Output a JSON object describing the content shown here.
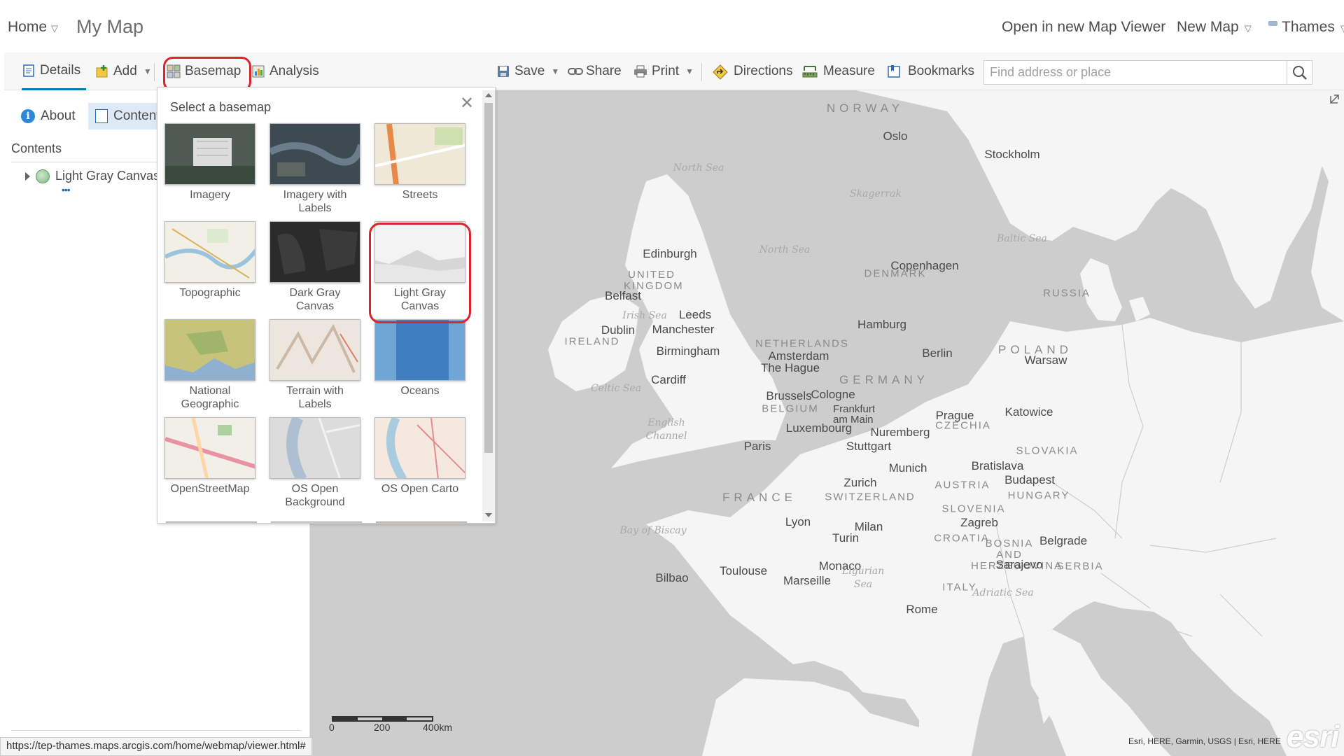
{
  "header": {
    "home_label": "Home",
    "map_title": "My Map",
    "open_new_viewer": "Open in new Map Viewer",
    "new_map": "New Map",
    "user_name": "Thames",
    "caret": "▽"
  },
  "toolbar": {
    "details": "Details",
    "add": "Add",
    "basemap": "Basemap",
    "analysis": "Analysis",
    "save": "Save",
    "share": "Share",
    "print": "Print",
    "directions": "Directions",
    "measure": "Measure",
    "bookmarks": "Bookmarks",
    "caret": "▼"
  },
  "search": {
    "placeholder": "Find address or place"
  },
  "left_panel": {
    "about_tab": "About",
    "content_tab": "Content",
    "contents_heading": "Contents",
    "layer_name": "Light Gray Canvas",
    "layer_options": "•••"
  },
  "gallery": {
    "heading": "Select a basemap",
    "close": "✕",
    "selected_index": 5,
    "tiles": [
      {
        "label": "Imagery",
        "thumb": "imagery"
      },
      {
        "label": "Imagery with Labels",
        "thumb": "imagery-labels"
      },
      {
        "label": "Streets",
        "thumb": "streets"
      },
      {
        "label": "Topographic",
        "thumb": "topographic"
      },
      {
        "label": "Dark Gray Canvas",
        "thumb": "dark-gray"
      },
      {
        "label": "Light Gray Canvas",
        "thumb": "light-gray"
      },
      {
        "label": "National Geographic",
        "thumb": "natgeo"
      },
      {
        "label": "Terrain with Labels",
        "thumb": "terrain"
      },
      {
        "label": "Oceans",
        "thumb": "oceans"
      },
      {
        "label": "OpenStreetMap",
        "thumb": "osm"
      },
      {
        "label": "OS Open Background",
        "thumb": "os-background"
      },
      {
        "label": "OS Open Carto",
        "thumb": "os-carto"
      }
    ]
  },
  "map": {
    "countries": [
      "NORWAY",
      "DENMARK",
      "UNITED KINGDOM",
      "IRELAND",
      "NETHERLANDS",
      "BELGIUM",
      "GERMANY",
      "POLAND",
      "RUSSIA",
      "FRANCE",
      "CZECHIA",
      "SLOVAKIA",
      "AUSTRIA",
      "HUNGARY",
      "SWITZERLAND",
      "SLOVENIA",
      "CROATIA",
      "BOSNIA AND HERZEGOVINA",
      "SERBIA",
      "ITALY"
    ],
    "cities": [
      "Oslo",
      "Stockholm",
      "Copenhagen",
      "Edinburgh",
      "Belfast",
      "Leeds",
      "Dublin",
      "Manchester",
      "Birmingham",
      "Cardiff",
      "Hamburg",
      "Amsterdam",
      "The Hague",
      "Berlin",
      "Warsaw",
      "Brussels",
      "Cologne",
      "Frankfurt am Main",
      "Luxembourg",
      "Prague",
      "Katowice",
      "Nuremberg",
      "Paris",
      "Stuttgart",
      "Munich",
      "Bratislava",
      "Budapest",
      "Zurich",
      "Lyon",
      "Milan",
      "Turin",
      "Zagreb",
      "Belgrade",
      "Monaco",
      "Toulouse",
      "Marseille",
      "Bilbao",
      "Sarajevo",
      "Rome"
    ],
    "seas": [
      "North Sea",
      "Skagerrak",
      "North Sea",
      "Baltic Sea",
      "Irish Sea",
      "Celtic Sea",
      "English Channel",
      "Bay of Biscay",
      "Ligurian Sea",
      "Adriatic Sea"
    ],
    "attribution": "Esri, HERE, Garmin, USGS | Esri, HERE",
    "logo": "esri",
    "scale_labels": [
      "0",
      "200",
      "400km"
    ],
    "land_color": "#f5f5f5",
    "water_color": "#cdcdcd"
  },
  "status_url": "https://tep-thames.maps.arcgis.com/home/webmap/viewer.html#",
  "colors": {
    "accent": "#0079c1",
    "highlight_ring": "#d9252b"
  }
}
